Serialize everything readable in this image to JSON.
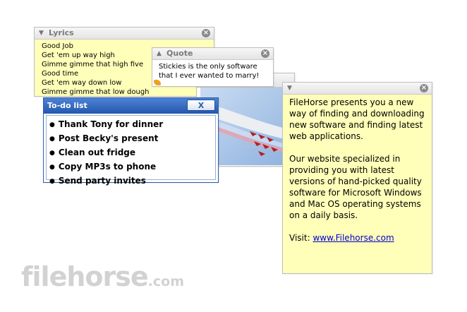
{
  "lyrics": {
    "title": "Lyrics",
    "lines": [
      "Good Job",
      "Get 'em up way high",
      "Gimme gimme that high five",
      "Good time",
      "Get 'em way down low",
      "Gimme gimme that low dough"
    ]
  },
  "quote": {
    "title": "Quote",
    "lines": [
      "Stickies is the only software",
      "that I ever wanted to marry!"
    ]
  },
  "todo": {
    "title": "To-do list",
    "close_label": "X",
    "items": [
      "Thank Tony for dinner",
      "Post Becky's present",
      "Clean out fridge",
      "Copy MP3s to phone",
      "Send party invites"
    ]
  },
  "filehorse_note": {
    "paragraph1": "FileHorse presents you a new way of finding and downloading new software and finding latest web applications.",
    "paragraph2": "Our website specialized in providing you with latest versions of hand-picked quality software for Microsoft Windows and Mac OS operating systems on a daily basis.",
    "visit_label": "Visit:",
    "link_text": "www.Filehorse.com"
  },
  "icons": {
    "collapse": "triangle-down-icon",
    "expand": "triangle-up-icon",
    "close": "circle-x-icon",
    "resize": "resize-grip-icon"
  },
  "colors": {
    "note_yellow": "#ffffb9",
    "todo_titlebar": "#2b5fa5",
    "link": "#0000cc"
  },
  "watermark": {
    "text": "filehorse",
    "suffix": ".com"
  }
}
